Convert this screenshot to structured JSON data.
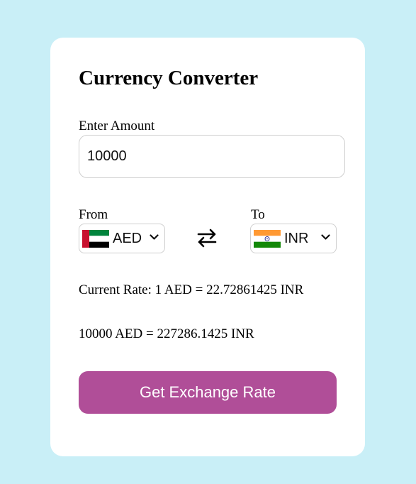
{
  "converter": {
    "title": "Currency Converter",
    "amount_label": "Enter Amount",
    "amount_value": "10000",
    "from_label": "From",
    "to_label": "To",
    "from_currency": "AED",
    "to_currency": "INR",
    "rate_text": "Current Rate: 1 AED = 22.72861425 INR",
    "result_text": "10000 AED = 227286.1425 INR",
    "button_label": "Get Exchange Rate"
  },
  "icons": {
    "from_flag": "uae-flag-icon",
    "to_flag": "india-flag-icon",
    "swap": "swap-arrows-icon",
    "dropdown": "chevron-down-icon"
  },
  "colors": {
    "page_background": "#c9eff7",
    "card_background": "#ffffff",
    "button_background": "#b04e98",
    "button_text": "#ffffff"
  }
}
